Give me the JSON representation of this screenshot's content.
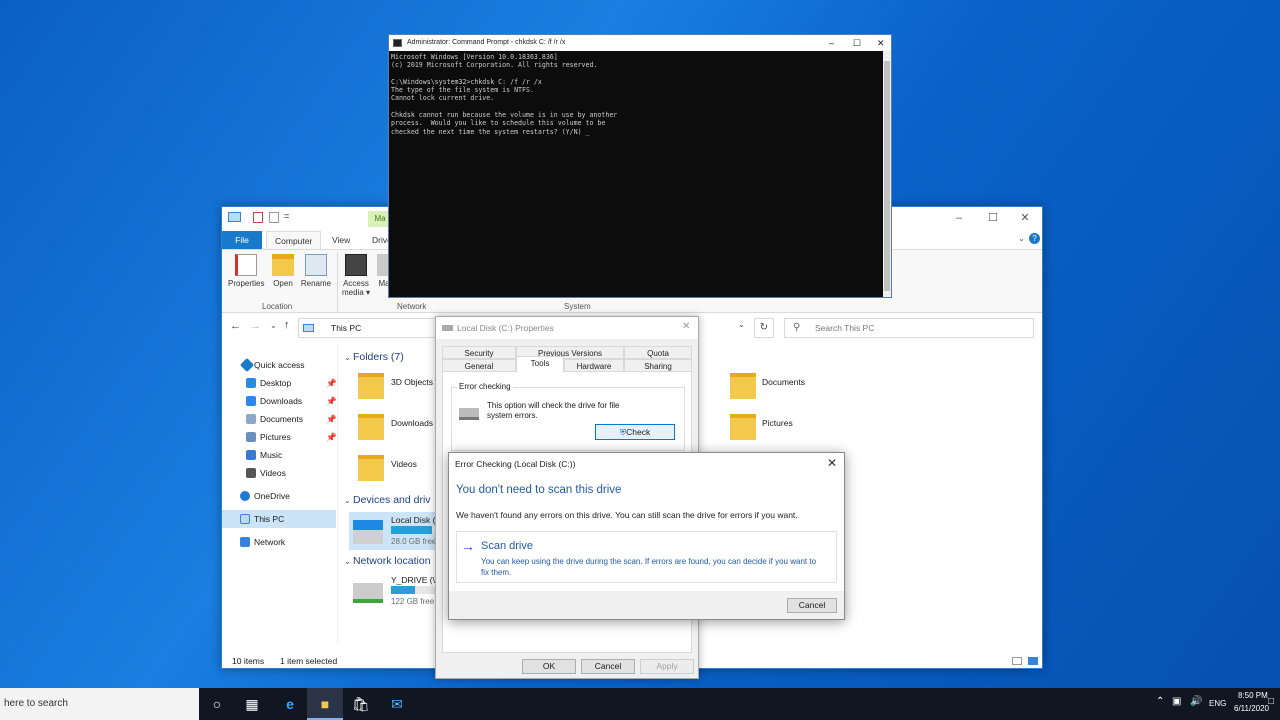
{
  "explorer": {
    "qat": "=",
    "tabs": {
      "file": "File",
      "computer": "Computer",
      "view": "View",
      "drive": "Drive",
      "manage": "Ma"
    },
    "ribbon": {
      "properties": "Properties",
      "open": "Open",
      "rename": "Rename",
      "access_media": "Access",
      "access_media2": "media ▾",
      "map": "Ma",
      "group_location": "Location",
      "group_network": "Network",
      "group_system": "System"
    },
    "address": "This PC",
    "search_placeholder": "Search This PC",
    "nav": {
      "quick_access": "Quick access",
      "desktop": "Desktop",
      "downloads": "Downloads",
      "documents": "Documents",
      "pictures": "Pictures",
      "music": "Music",
      "videos": "Videos",
      "onedrive": "OneDrive",
      "this_pc": "This PC",
      "network": "Network"
    },
    "sections": {
      "folders": "Folders (7)",
      "devices": "Devices and driv",
      "netloc": "Network location"
    },
    "folders": {
      "objects3d": "3D Objects",
      "downloads": "Downloads",
      "videos": "Videos",
      "documents": "Documents",
      "pictures": "Pictures"
    },
    "drives": {
      "local_name": "Local Disk (",
      "local_free": "28.0 GB free",
      "y_name": "Y_DRIVE (\\\\",
      "y_free": "122 GB free"
    },
    "local_used_fraction": 0.85,
    "y_used_fraction": 0.5,
    "status_items": "10 items",
    "status_selected": "1 item selected"
  },
  "cmd": {
    "title": "Administrator: Command Prompt - chkdsk  C: /f /r /x",
    "lines": "Microsoft Windows [Version 10.0.18363.836]\n(c) 2019 Microsoft Corporation. All rights reserved.\n\nC:\\Windows\\system32>chkdsk C: /f /r /x\nThe type of the file system is NTFS.\nCannot lock current drive.\n\nChkdsk cannot run because the volume is in use by another\nprocess.  Would you like to schedule this volume to be\nchecked the next time the system restarts? (Y/N) _"
  },
  "props": {
    "title": "Local Disk (C:) Properties",
    "tabs": {
      "security": "Security",
      "previous": "Previous Versions",
      "quota": "Quota",
      "general": "General",
      "tools": "Tools",
      "hardware": "Hardware",
      "sharing": "Sharing"
    },
    "error_group": "Error checking",
    "error_text": "This option will check the drive for file system errors.",
    "check": "Check",
    "ok": "OK",
    "cancel": "Cancel",
    "apply": "Apply"
  },
  "errc": {
    "title": "Error Checking (Local Disk (C:))",
    "heading": "You don't need to scan this drive",
    "body": "We haven't found any errors on this drive. You can still scan the drive for errors if you want.",
    "scan_title": "Scan drive",
    "scan_desc": "You can keep using the drive during the scan. If errors are found, you can decide if you want to fix them.",
    "cancel": "Cancel"
  },
  "taskbar": {
    "search": "here to search",
    "lang": "ENG",
    "time": "8:50 PM",
    "date": "6/11/2020"
  },
  "colors": {
    "accent": "#0078d7",
    "heading": "#1f5ba8",
    "desktop": "#0b5fc4"
  }
}
